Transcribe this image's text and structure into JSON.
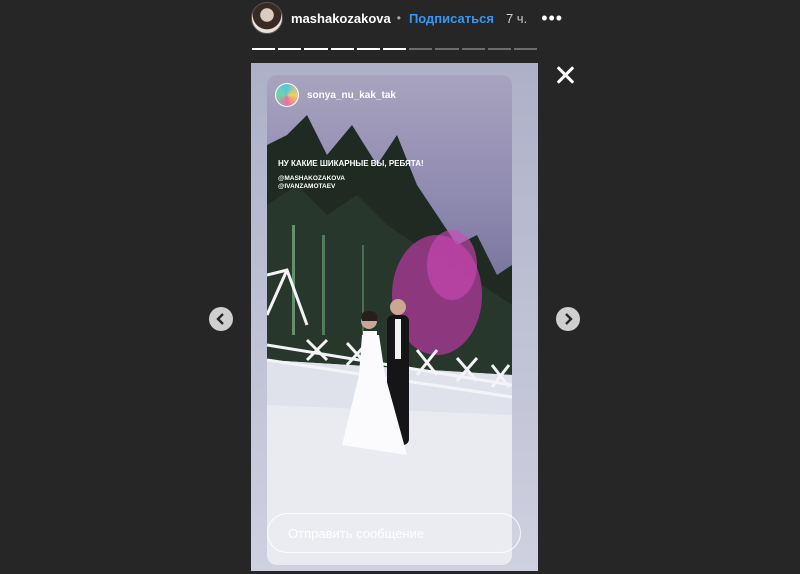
{
  "header": {
    "username": "mashakozakova",
    "separator": "•",
    "follow_label": "Подписаться",
    "time": "7 ч.",
    "more_label": "•••"
  },
  "progress": {
    "total": 11,
    "completed": 6
  },
  "story": {
    "author": "sonya_nu_kak_tak",
    "caption": "НУ КАКИЕ ШИКАРНЫЕ ВЫ, РЕБЯТА!",
    "mentions": [
      "@MASHAKOZAKOVA",
      "@IVANZAMOTAEV"
    ]
  },
  "reply": {
    "placeholder": "Отправить сообщение"
  },
  "icons": {
    "close": "close-icon",
    "prev": "chevron-left-icon",
    "next": "chevron-right-icon",
    "more": "more-options-icon"
  }
}
